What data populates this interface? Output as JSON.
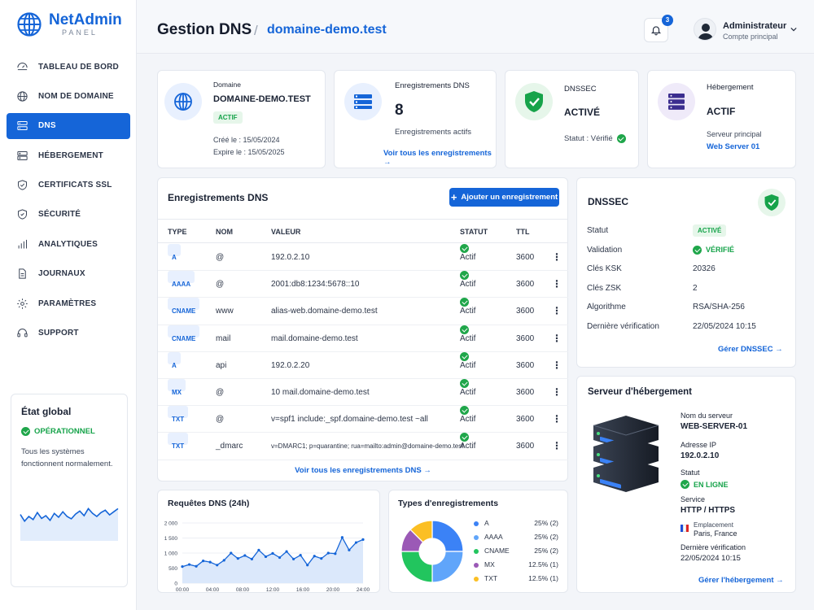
{
  "brand": {
    "name": "NetAdmin",
    "sub": "PANEL"
  },
  "nav": [
    {
      "label": "TABLEAU DE BORD",
      "icon": "dashboard-icon"
    },
    {
      "label": "NOM DE DOMAINE",
      "icon": "globe-icon"
    },
    {
      "label": "DNS",
      "icon": "server-icon",
      "active": true
    },
    {
      "label": "HÉBERGEMENT",
      "icon": "hosting-icon"
    },
    {
      "label": "CERTIFICATS SSL",
      "icon": "shield-check-icon"
    },
    {
      "label": "SÉCURITÉ",
      "icon": "shield-icon"
    },
    {
      "label": "ANALYTIQUES",
      "icon": "bar-chart-icon"
    },
    {
      "label": "JOURNAUX",
      "icon": "document-icon"
    },
    {
      "label": "PARAMÈTRES",
      "icon": "gear-icon"
    },
    {
      "label": "SUPPORT",
      "icon": "headset-icon"
    }
  ],
  "global_status": {
    "title": "État global",
    "status": "OPÉRATIONNEL",
    "message": "Tous les systèmes fonctionnent normalement.",
    "sparkline": [
      0.45,
      0.62,
      0.5,
      0.58,
      0.4,
      0.55,
      0.48,
      0.6,
      0.42,
      0.52,
      0.38,
      0.5,
      0.56,
      0.44,
      0.36,
      0.48,
      0.3,
      0.42,
      0.5,
      0.4,
      0.34,
      0.46,
      0.38,
      0.3
    ]
  },
  "header": {
    "title": "Gestion DNS",
    "separator": "/",
    "domain": "domaine-demo.test",
    "notifications": "3",
    "user_name": "Administrateur",
    "user_role": "Compte principal"
  },
  "summary": {
    "domain": {
      "label": "Domaine",
      "name": "DOMAINE-DEMO.TEST",
      "status": "ACTIF",
      "created": "Créé le : 15/05/2024",
      "expires": "Expire le : 15/05/2025"
    },
    "records": {
      "label": "Enregistrements DNS",
      "count": "8",
      "sub": "Enregistrements actifs",
      "link": "Voir tous les enregistrements"
    },
    "dnssec": {
      "label": "DNSSEC",
      "value": "ACTIVÉ",
      "status": "Statut : Vérifié"
    },
    "hosting": {
      "label": "Hébergement",
      "value": "ACTIF",
      "sub": "Serveur principal",
      "server": "Web Server 01"
    }
  },
  "dns_table": {
    "title": "Enregistrements DNS",
    "add_button": "Ajouter un enregistrement",
    "columns": [
      "TYPE",
      "NOM",
      "VALEUR",
      "STATUT",
      "TTL"
    ],
    "rows": [
      {
        "type": "A",
        "name": "@",
        "value": "192.0.2.10",
        "status": "Actif",
        "ttl": "3600"
      },
      {
        "type": "AAAA",
        "name": "@",
        "value": "2001:db8:1234:5678::10",
        "status": "Actif",
        "ttl": "3600"
      },
      {
        "type": "CNAME",
        "name": "www",
        "value": "alias-web.domaine-demo.test",
        "status": "Actif",
        "ttl": "3600"
      },
      {
        "type": "CNAME",
        "name": "mail",
        "value": "mail.domaine-demo.test",
        "status": "Actif",
        "ttl": "3600"
      },
      {
        "type": "A",
        "name": "api",
        "value": "192.0.2.20",
        "status": "Actif",
        "ttl": "3600"
      },
      {
        "type": "MX",
        "name": "@",
        "value": "10 mail.domaine-demo.test",
        "status": "Actif",
        "ttl": "3600"
      },
      {
        "type": "TXT",
        "name": "@",
        "value": "v=spf1 include:_spf.domaine-demo.test ~all",
        "status": "Actif",
        "ttl": "3600"
      },
      {
        "type": "TXT",
        "name": "_dmarc",
        "value": "v=DMARC1; p=quarantine; rua=mailto:admin@domaine-demo.test",
        "status": "Actif",
        "ttl": "3600"
      }
    ],
    "footer_link": "Voir tous les enregistrements DNS"
  },
  "dnssec_panel": {
    "title": "DNSSEC",
    "rows": [
      {
        "k": "Statut",
        "v": "ACTIVÉ"
      },
      {
        "k": "Validation",
        "v": "VÉRIFIÉ"
      },
      {
        "k": "Clés KSK",
        "v": "20326"
      },
      {
        "k": "Clés ZSK",
        "v": "2"
      },
      {
        "k": "Algorithme",
        "v": "RSA/SHA-256"
      },
      {
        "k": "Dernière vérification",
        "v": "22/05/2024 10:15"
      }
    ],
    "link": "Gérer DNSSEC"
  },
  "server_panel": {
    "title": "Serveur d'hébergement",
    "name_label": "Nom du serveur",
    "name": "WEB-SERVER-01",
    "ip_label": "Adresse IP",
    "ip": "192.0.2.10",
    "status_label": "Statut",
    "status": "EN LIGNE",
    "service_label": "Service",
    "service": "HTTP / HTTPS",
    "location_label": "Emplacement",
    "location": "Paris, France",
    "check_label": "Dernière vérification",
    "check": "22/05/2024 10:15",
    "link": "Gérer l'hébergement"
  },
  "colors": {
    "accent": "#1565d8",
    "success": "#16a34a"
  },
  "chart_data": [
    {
      "type": "area",
      "title": "Requêtes DNS (24h)",
      "x": [
        "00:00",
        "00:55",
        "01:50",
        "02:45",
        "03:40",
        "04:35",
        "05:30",
        "06:25",
        "07:20",
        "08:15",
        "09:10",
        "10:05",
        "11:00",
        "11:55",
        "12:50",
        "13:45",
        "14:40",
        "15:35",
        "16:30",
        "17:25",
        "18:20",
        "19:15",
        "20:10",
        "21:05",
        "22:00",
        "22:55",
        "23:50"
      ],
      "x_ticks": [
        "00:00",
        "04:00",
        "08:00",
        "12:00",
        "16:00",
        "20:00",
        "24:00"
      ],
      "values": [
        550,
        620,
        560,
        740,
        700,
        600,
        760,
        1000,
        820,
        920,
        800,
        1100,
        880,
        990,
        850,
        1050,
        800,
        930,
        600,
        900,
        820,
        1000,
        980,
        1520,
        1100,
        1350,
        1450
      ],
      "ylim": [
        0,
        2000
      ],
      "y_ticks": [
        "2 000",
        "1 500",
        "1 000",
        "500",
        "0"
      ],
      "grid": true
    },
    {
      "type": "pie",
      "title": "Types d'enregistrements",
      "slices": [
        {
          "label": "A",
          "pct": "25% (2)",
          "value": 25,
          "color": "#3b82f6"
        },
        {
          "label": "AAAA",
          "pct": "25% (2)",
          "value": 25,
          "color": "#60a5fa"
        },
        {
          "label": "CNAME",
          "pct": "25% (2)",
          "value": 25,
          "color": "#22c55e"
        },
        {
          "label": "MX",
          "pct": "12.5% (1)",
          "value": 12.5,
          "color": "#9b59b6"
        },
        {
          "label": "TXT",
          "pct": "12.5% (1)",
          "value": 12.5,
          "color": "#fbbf24"
        }
      ]
    }
  ]
}
